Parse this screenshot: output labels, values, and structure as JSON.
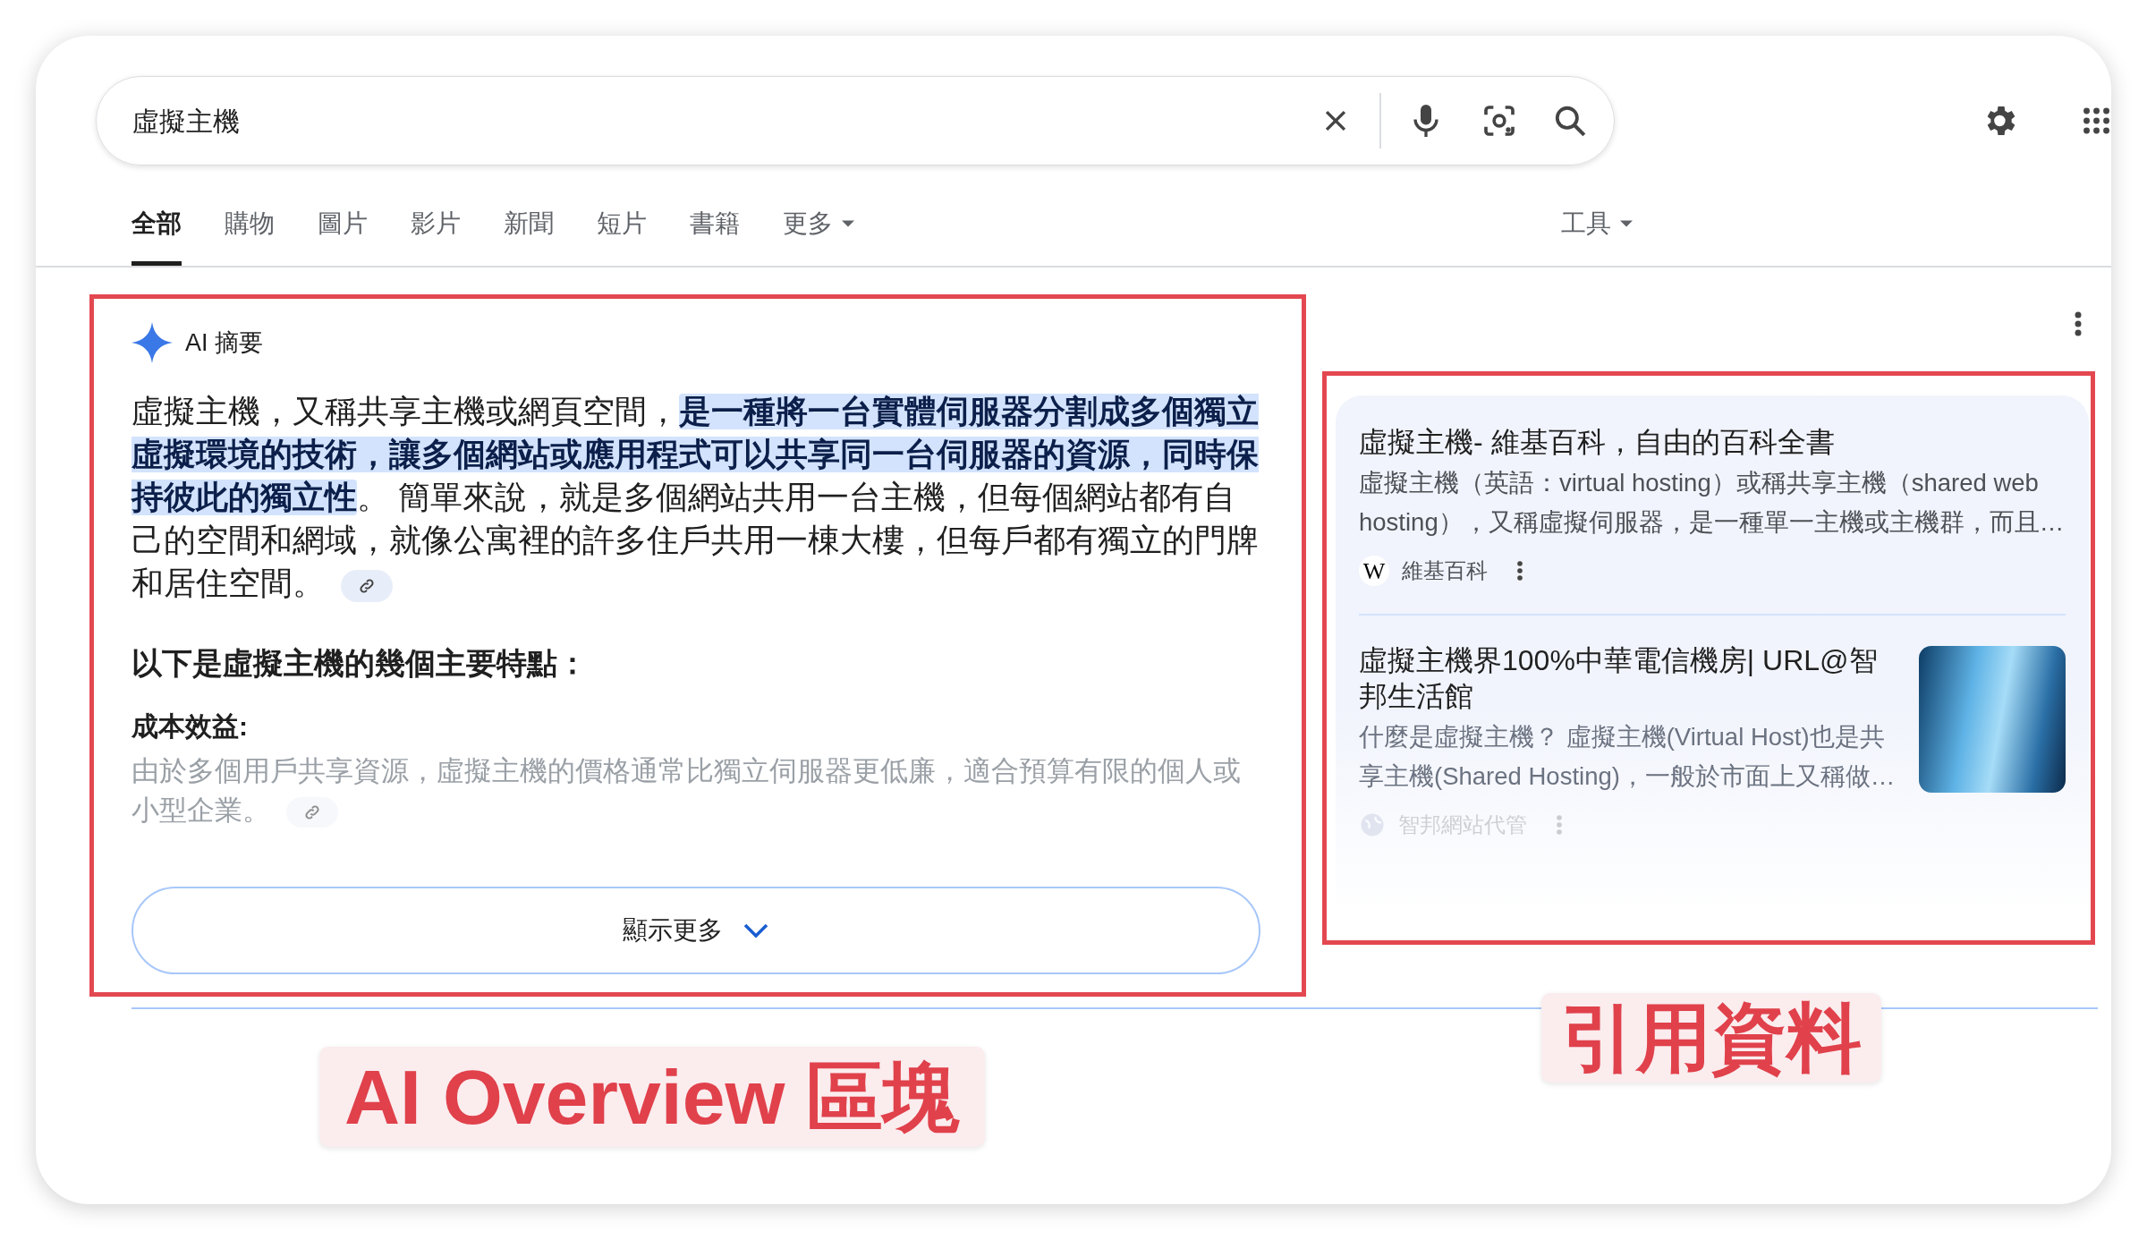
{
  "search": {
    "query": "虛擬主機"
  },
  "tabs": [
    {
      "label": "全部",
      "selected": true,
      "kind": "tab"
    },
    {
      "label": "購物",
      "selected": false,
      "kind": "tab"
    },
    {
      "label": "圖片",
      "selected": false,
      "kind": "tab"
    },
    {
      "label": "影片",
      "selected": false,
      "kind": "tab"
    },
    {
      "label": "新聞",
      "selected": false,
      "kind": "tab"
    },
    {
      "label": "短片",
      "selected": false,
      "kind": "tab"
    },
    {
      "label": "書籍",
      "selected": false,
      "kind": "tab"
    },
    {
      "label": "更多",
      "selected": false,
      "kind": "menu"
    }
  ],
  "tools": {
    "label": "工具"
  },
  "ai_overview": {
    "title": "AI 摘要",
    "paragraph": [
      {
        "text": "虛擬主機，又稱共享主機或網頁空間，",
        "highlighted": false
      },
      {
        "text": "是一種將一台實體伺服器分割成多個獨立虛擬環境的技術，讓多個網站或應用程式可以共享同一台伺服器的資源，同時保持彼此的獨立性",
        "highlighted": true
      },
      {
        "text": "。 簡單來說，就是多個網站共用一台主機，但每個網站都有自己的空間和網域，就像公寓裡的許多住戶共用一棟大樓，但每戶都有獨立的門牌和居住空間。",
        "highlighted": false
      }
    ],
    "subheading": "以下是虛擬主機的幾個主要特點：",
    "features": [
      {
        "title": "成本效益:",
        "text": "由於多個用戶共享資源，虛擬主機的價格通常比獨立伺服器更低廉，適合預算有限的個人或小型企業。"
      }
    ],
    "show_more": "顯示更多"
  },
  "sources": [
    {
      "title": "虛擬主機- 維基百科，自由的百科全書",
      "snippet": "虛擬主機（英語：virtual hosting）或稱共享主機（shared web hosting），又稱虛擬伺服器，是一種單一主機或主機群，而且…",
      "site": "維基百科",
      "site_logo": "W",
      "thumbnail": false
    },
    {
      "title": "虛擬主機界100%中華電信機房| URL@智邦生活館",
      "snippet": "什麼是虛擬主機？ 虛擬主機(Virtual Host)也是共享主機(Shared Hosting)，一般於市面上又稱做…",
      "site": "智邦網站代管",
      "thumbnail": true
    }
  ],
  "annotations": [
    "AI Overview 區塊",
    "引用資料"
  ]
}
